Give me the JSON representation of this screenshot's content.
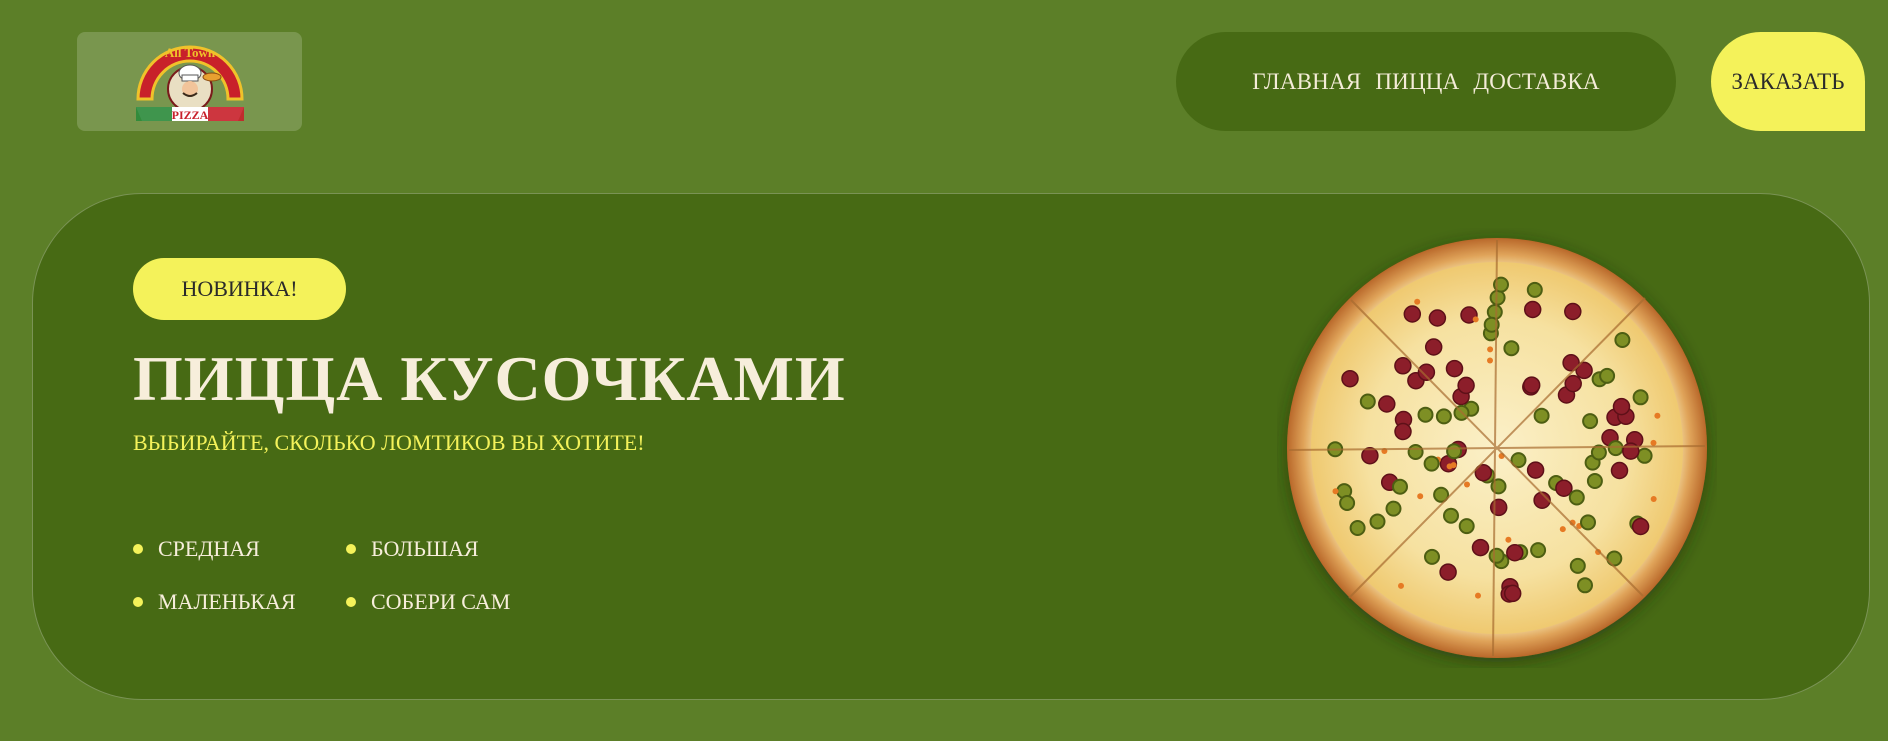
{
  "logo": {
    "top_text": "All Town",
    "bottom_text": "PIZZA"
  },
  "nav": {
    "items": [
      "ГЛАВНАЯ",
      "ПИЦЦА",
      "ДОСТАВКА"
    ]
  },
  "order_button": "ЗАКАЗАТЬ",
  "hero": {
    "badge": "НОВИНКА!",
    "title": "ПИЦЦА КУСОЧКАМИ",
    "subtitle": "ВЫБИРАЙТЕ, СКОЛЬКО ЛОМТИКОВ ВЫ ХОТИТЕ!",
    "sizes": [
      "СРЕДНАЯ",
      "БОЛЬШАЯ",
      "МАЛЕНЬКАЯ",
      "СОБЕРИ САМ"
    ]
  },
  "colors": {
    "page_bg": "#5c7f28",
    "panel_bg": "#476a14",
    "accent_yellow": "#f4f25a",
    "cream_text": "#f7eedb"
  },
  "icons": {
    "logo": "chef-pizza-logo",
    "bullet": "yellow-dot",
    "hero_image": "pizza-image"
  }
}
